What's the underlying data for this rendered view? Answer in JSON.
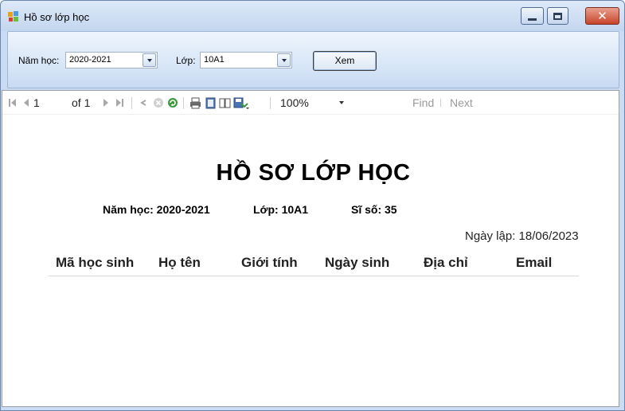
{
  "window": {
    "title": "Hồ sơ lớp học",
    "controls": {
      "close_glyph": "✕"
    }
  },
  "filters": {
    "school_year_label": "Năm học:",
    "school_year_value": "2020-2021",
    "class_label": "Lớp:",
    "class_value": "10A1",
    "view_button": "Xem"
  },
  "toolbar": {
    "current_page": "1",
    "of_pages": "of 1",
    "zoom": "100%",
    "find_label": "Find",
    "next_label": "Next",
    "separator": "|"
  },
  "report": {
    "title": "HỒ SƠ LỚP HỌC",
    "school_year": "Năm học: 2020-2021",
    "class": "Lớp: 10A1",
    "size": "Sĩ số: 35",
    "created_date": "Ngày lập: 18/06/2023",
    "columns": [
      "Mã học sinh",
      "Họ tên",
      "Giới tính",
      "Ngày sinh",
      "Địa chỉ",
      "Email"
    ]
  }
}
